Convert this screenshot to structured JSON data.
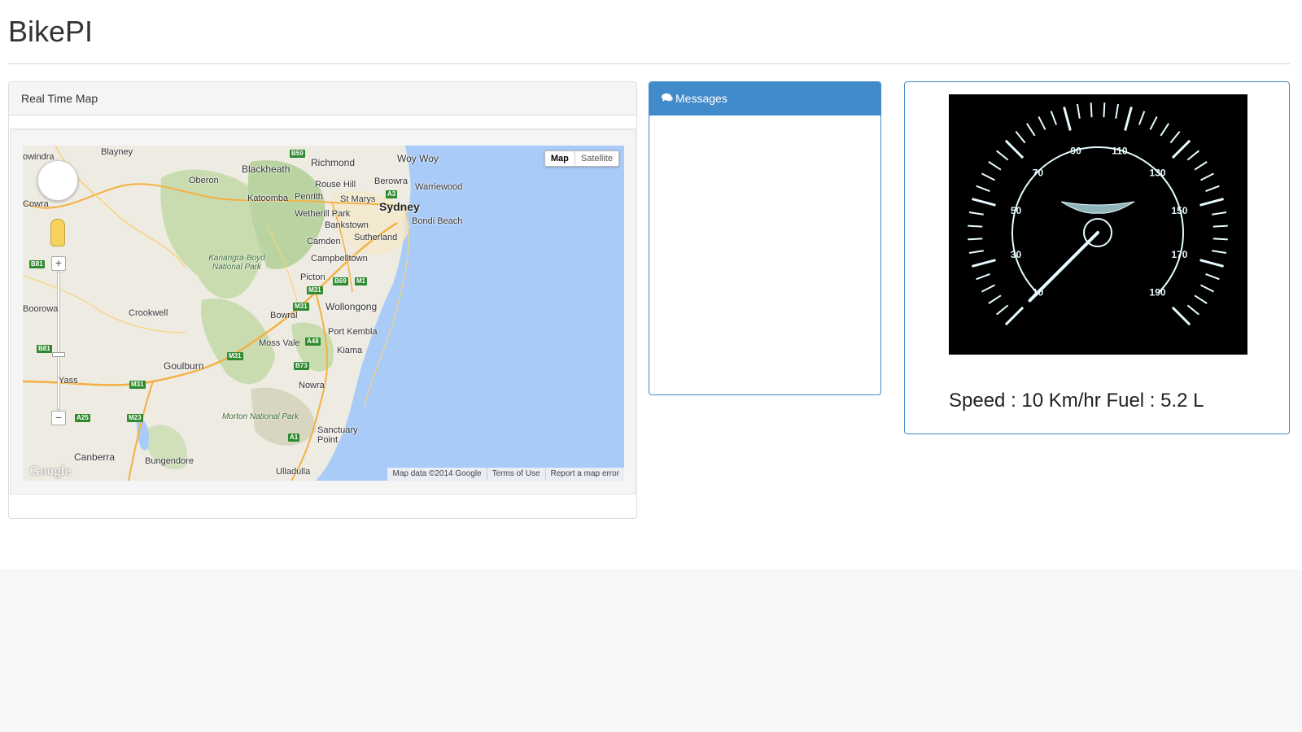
{
  "app": {
    "title": "BikePI"
  },
  "map_panel": {
    "heading": "Real Time Map",
    "map_type": {
      "map_label": "Map",
      "satellite_label": "Satellite",
      "selected": "Map"
    },
    "footer": {
      "data": "Map data ©2014 Google",
      "terms": "Terms of Use",
      "report": "Report a map error"
    },
    "logo_text": "Google",
    "places": [
      {
        "name": "owindra"
      },
      {
        "name": "Blayney"
      },
      {
        "name": "Richmond"
      },
      {
        "name": "Woy Woy"
      },
      {
        "name": "Blackheath"
      },
      {
        "name": "Oberon"
      },
      {
        "name": "Berowra"
      },
      {
        "name": "Warriewood"
      },
      {
        "name": "Cowra"
      },
      {
        "name": "Katoomba"
      },
      {
        "name": "Penrith"
      },
      {
        "name": "Rouse Hill"
      },
      {
        "name": "St Marys"
      },
      {
        "name": "Sydney"
      },
      {
        "name": "Wetherill Park"
      },
      {
        "name": "Bondi Beach"
      },
      {
        "name": "Bankstown"
      },
      {
        "name": "Kanangra-Boyd National Park"
      },
      {
        "name": "Camden"
      },
      {
        "name": "Sutherland"
      },
      {
        "name": "Campbelltown"
      },
      {
        "name": "Picton"
      },
      {
        "name": "Boorowa"
      },
      {
        "name": "Crookwell"
      },
      {
        "name": "Wollongong"
      },
      {
        "name": "Bowral"
      },
      {
        "name": "Port Kembla"
      },
      {
        "name": "Moss Vale"
      },
      {
        "name": "Kiama"
      },
      {
        "name": "Goulburn"
      },
      {
        "name": "Yass"
      },
      {
        "name": "Nowra"
      },
      {
        "name": "Morton National Park"
      },
      {
        "name": "Sanctuary Point"
      },
      {
        "name": "Canberra"
      },
      {
        "name": "Bungendore"
      },
      {
        "name": "Ulladulla"
      }
    ],
    "shields": [
      "B59",
      "A3",
      "B81",
      "B69",
      "M1",
      "M31",
      "M31",
      "A48",
      "M31",
      "B73",
      "B81",
      "M31",
      "A25",
      "M23",
      "A1"
    ]
  },
  "messages_panel": {
    "heading": "Messages",
    "icon": "comments-icon",
    "messages": []
  },
  "speed_panel": {
    "gauge": {
      "tick_labels": [
        "10",
        "30",
        "50",
        "70",
        "90",
        "110",
        "130",
        "150",
        "170",
        "190"
      ],
      "needle_value": 10,
      "min": 10,
      "max": 190
    },
    "readout": "Speed : 10 Km/hr Fuel : 5.2 L",
    "speed": 10,
    "speed_unit": "Km/hr",
    "fuel": 5.2,
    "fuel_unit": "L"
  },
  "colors": {
    "primary": "#428bca",
    "gauge_bg": "#000000",
    "gauge_ink": "#e6fbff",
    "water": "#a9cbf7",
    "land": "#eeebe3",
    "park": "#c8dcb0"
  }
}
